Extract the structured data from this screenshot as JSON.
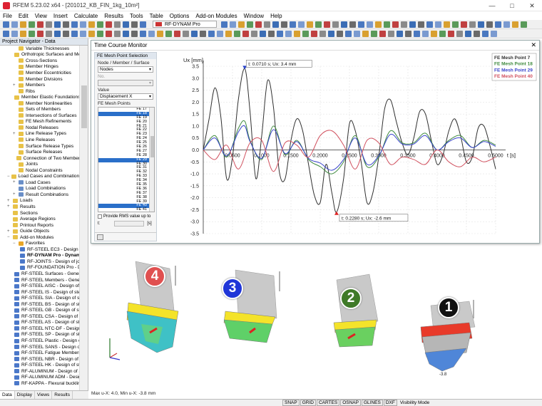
{
  "window": {
    "title": "RFEM 5.23.02 x64 - [201012_KB_FIN_1kg_10m²]",
    "controls": [
      "—",
      "□",
      "✕"
    ]
  },
  "menu": [
    "File",
    "Edit",
    "View",
    "Insert",
    "Calculate",
    "Results",
    "Tools",
    "Table",
    "Options",
    "Add-on Modules",
    "Window",
    "Help"
  ],
  "toolbar": {
    "module_selector": "RF-DYNAM Pro"
  },
  "navigator": {
    "title": "Project Navigator - Data",
    "items": [
      {
        "label": "Variable Thicknesses",
        "indent": 2,
        "icon": "folder"
      },
      {
        "label": "Orthotropic Surfaces and Me",
        "indent": 2,
        "icon": "folder"
      },
      {
        "label": "Cross-Sections",
        "indent": 2,
        "icon": "folder"
      },
      {
        "label": "Member Hinges",
        "indent": 2,
        "icon": "folder"
      },
      {
        "label": "Member Eccentricities",
        "indent": 2,
        "icon": "folder"
      },
      {
        "label": "Member Divisions",
        "indent": 2,
        "icon": "folder"
      },
      {
        "label": "Members",
        "indent": 2,
        "icon": "folder",
        "exp": "+"
      },
      {
        "label": "Ribs",
        "indent": 2,
        "icon": "folder"
      },
      {
        "label": "Member Elastic Foundations",
        "indent": 2,
        "icon": "folder"
      },
      {
        "label": "Member Nonlinearities",
        "indent": 2,
        "icon": "folder"
      },
      {
        "label": "Sets of Members",
        "indent": 2,
        "icon": "folder"
      },
      {
        "label": "Intersections of Surfaces",
        "indent": 2,
        "icon": "folder"
      },
      {
        "label": "FE Mesh Refinements",
        "indent": 2,
        "icon": "folder"
      },
      {
        "label": "Nodal Releases",
        "indent": 2,
        "icon": "folder"
      },
      {
        "label": "Line Release Types",
        "indent": 2,
        "icon": "folder",
        "exp": "+"
      },
      {
        "label": "Line Releases",
        "indent": 2,
        "icon": "folder"
      },
      {
        "label": "Surface Release Types",
        "indent": 2,
        "icon": "folder"
      },
      {
        "label": "Surface Releases",
        "indent": 2,
        "icon": "folder"
      },
      {
        "label": "Connection of Two Member",
        "indent": 2,
        "icon": "folder"
      },
      {
        "label": "Joints",
        "indent": 2,
        "icon": "folder"
      },
      {
        "label": "Nodal Constraints",
        "indent": 2,
        "icon": "folder"
      },
      {
        "label": "Load Cases and Combinations",
        "indent": 1,
        "icon": "folder",
        "exp": "−"
      },
      {
        "label": "Load Cases",
        "indent": 2,
        "icon": "item",
        "exp": "+"
      },
      {
        "label": "Load Combinations",
        "indent": 2,
        "icon": "item"
      },
      {
        "label": "Result Combinations",
        "indent": 2,
        "icon": "item",
        "exp": "+"
      },
      {
        "label": "Loads",
        "indent": 1,
        "icon": "folder",
        "exp": "+"
      },
      {
        "label": "Results",
        "indent": 1,
        "icon": "folder",
        "exp": "+"
      },
      {
        "label": "Sections",
        "indent": 1,
        "icon": "folder"
      },
      {
        "label": "Average Regions",
        "indent": 1,
        "icon": "folder"
      },
      {
        "label": "Printout Reports",
        "indent": 1,
        "icon": "folder"
      },
      {
        "label": "Guide Objects",
        "indent": 1,
        "icon": "folder",
        "exp": "+"
      },
      {
        "label": "Add-on Modules",
        "indent": 1,
        "icon": "folder",
        "exp": "−"
      },
      {
        "label": "Favorites",
        "indent": 2,
        "icon": "fav",
        "exp": "−"
      },
      {
        "label": "RF-STEEL EC3 - Design of st",
        "indent": 3,
        "icon": "mod"
      },
      {
        "label": "RF-DYNAM Pro - Dynam",
        "indent": 3,
        "icon": "mod",
        "bold": true
      },
      {
        "label": "RF-JOINTS - Design of jo",
        "indent": 3,
        "icon": "mod"
      },
      {
        "label": "RF-FOUNDATION Pro - D",
        "indent": 3,
        "icon": "mod"
      },
      {
        "label": "RF-STEEL Surfaces - General",
        "indent": 2,
        "icon": "mod"
      },
      {
        "label": "RF-STEEL Members - Genera",
        "indent": 2,
        "icon": "mod"
      },
      {
        "label": "RF-STEEL AISC - Design of st",
        "indent": 2,
        "icon": "mod"
      },
      {
        "label": "RF-STEEL IS - Design of stee",
        "indent": 2,
        "icon": "mod"
      },
      {
        "label": "RF-STEEL SIA - Design of ste",
        "indent": 2,
        "icon": "mod"
      },
      {
        "label": "RF-STEEL BS - Design of stee",
        "indent": 2,
        "icon": "mod"
      },
      {
        "label": "RF-STEEL GB - Design of ste",
        "indent": 2,
        "icon": "mod"
      },
      {
        "label": "RF-STEEL CSA - Design of st",
        "indent": 2,
        "icon": "mod"
      },
      {
        "label": "RF-STEEL AS - Design of ste",
        "indent": 2,
        "icon": "mod"
      },
      {
        "label": "RF-STEEL NTC-DF - Design",
        "indent": 2,
        "icon": "mod"
      },
      {
        "label": "RF-STEEL SP - Design of ste",
        "indent": 2,
        "icon": "mod"
      },
      {
        "label": "RF-STEEL Plastic - Design o",
        "indent": 2,
        "icon": "mod"
      },
      {
        "label": "RF-STEEL SANS - Design of st",
        "indent": 2,
        "icon": "mod"
      },
      {
        "label": "RF-STEEL Fatigue Members -",
        "indent": 2,
        "icon": "mod"
      },
      {
        "label": "RF-STEEL NBR - Design of st",
        "indent": 2,
        "icon": "mod"
      },
      {
        "label": "RF-STEEL HK - Design of ste",
        "indent": 2,
        "icon": "mod"
      },
      {
        "label": "RF-ALUMINUM - Design of a",
        "indent": 2,
        "icon": "mod"
      },
      {
        "label": "RF-ALUMINUM ADM - Design",
        "indent": 2,
        "icon": "mod"
      },
      {
        "label": "RF-KAPPA - Flexural bucklin",
        "indent": 2,
        "icon": "mod"
      }
    ],
    "tabs": [
      "Data",
      "Display",
      "Views",
      "Results"
    ]
  },
  "monitor": {
    "title": "Time Course Monitor",
    "close": "✕",
    "selection": {
      "header": "FE Mesh Point Selection",
      "node_label": "Node / Member / Surface",
      "node_value": "Nodes",
      "no_label": "No.",
      "value_label": "Value",
      "value_value": "Displacement X",
      "points_label": "FE Mesh Points",
      "points": [
        "FE 17",
        "FE 18",
        "FE 19",
        "FE 20",
        "FE 21",
        "FE 22",
        "FE 23",
        "FE 24",
        "FE 25",
        "FE 26",
        "FE 27",
        "FE 28",
        "FE 29",
        "FE 30",
        "FE 31",
        "FE 32",
        "FE 33",
        "FE 34",
        "FE 35",
        "FE 36",
        "FE 37",
        "FE 38",
        "FE 39",
        "FE 40",
        "FE 41"
      ],
      "selected_points": [
        "FE 18",
        "FE 29",
        "FE 40"
      ],
      "rms_label": "Provide RMS value up to",
      "t_label": "t:",
      "t_unit": "[s]"
    }
  },
  "chart_data": {
    "type": "line",
    "ylabel": "Ux [mm]",
    "xlabel": "t [s]",
    "xlim": [
      0,
      0.5
    ],
    "ylim": [
      -3.5,
      3.5
    ],
    "x_ticks": [
      0.05,
      0.1,
      0.15,
      0.2,
      0.25,
      0.3,
      0.35,
      0.4,
      0.45,
      0.5
    ],
    "x_tick_labels": [
      "0.0500",
      "0.1000",
      "0.1500",
      "0.2000",
      "0.2500",
      "0.3000",
      "0.3500",
      "0.4000",
      "0.4500",
      "0.5000"
    ],
    "y_ticks": [
      -3.5,
      -3,
      -2.5,
      -2,
      -1.5,
      -1,
      -0.5,
      0,
      0.5,
      1,
      1.5,
      2,
      2.5,
      3,
      3.5
    ],
    "y_tick_labels": [
      "-3.5",
      "-3.0",
      "-2.5",
      "-2.0",
      "-1.5",
      "-1.0",
      "-0.5",
      "0.0",
      "0.5",
      "1.0",
      "1.5",
      "2.0",
      "2.5",
      "3.0",
      "3.5"
    ],
    "grid": true,
    "legend_position": "top-right",
    "series": [
      {
        "name": "FE Mesh Point 7",
        "color": "#303030",
        "x": [
          0,
          0.01,
          0.02,
          0.03,
          0.04,
          0.05,
          0.06,
          0.071,
          0.08,
          0.09,
          0.1,
          0.11,
          0.12,
          0.13,
          0.14,
          0.15,
          0.16,
          0.17,
          0.18,
          0.19,
          0.2,
          0.21,
          0.22,
          0.228,
          0.24,
          0.25,
          0.26,
          0.27,
          0.28,
          0.29,
          0.3,
          0.31,
          0.32,
          0.33,
          0.34,
          0.35,
          0.36,
          0.37,
          0.38,
          0.39,
          0.4,
          0.41,
          0.42,
          0.43,
          0.44,
          0.45,
          0.46,
          0.47,
          0.48,
          0.49,
          0.5
        ],
        "y": [
          0,
          1.3,
          2.6,
          1.4,
          -1.2,
          -0.3,
          2.1,
          3.4,
          1.6,
          -1.2,
          0.6,
          2.9,
          1.8,
          -0.9,
          -1.2,
          0.4,
          1.3,
          0.8,
          -0.6,
          -1.9,
          -2.2,
          -0.6,
          -1.8,
          -2.6,
          -1.2,
          1.1,
          0.8,
          -0.5,
          -2.2,
          -1.8,
          -0.3,
          1.7,
          2.1,
          1.2,
          0.3,
          -0.2,
          0.5,
          1.6,
          1.5,
          0.4,
          -0.6,
          -0.2,
          0.8,
          1.3,
          0.6,
          -0.5,
          -0.3,
          0.9,
          1.0,
          0.2,
          -0.8
        ]
      },
      {
        "name": "FE Mesh Point 18",
        "color": "#3f8a3f",
        "x": [
          0,
          0.02,
          0.04,
          0.06,
          0.071,
          0.08,
          0.1,
          0.12,
          0.14,
          0.16,
          0.18,
          0.2,
          0.22,
          0.24,
          0.26,
          0.28,
          0.3,
          0.32,
          0.34,
          0.36,
          0.38,
          0.4,
          0.42,
          0.44,
          0.46,
          0.48,
          0.5
        ],
        "y": [
          0,
          0.6,
          -0.3,
          0.9,
          1.2,
          0.4,
          -0.4,
          1.0,
          -0.2,
          0.4,
          -0.4,
          -0.7,
          -1.0,
          -0.5,
          0.6,
          -0.7,
          -0.3,
          0.8,
          0.3,
          0.3,
          0.7,
          0.0,
          0.4,
          0.6,
          0.1,
          0.4,
          0.2
        ]
      },
      {
        "name": "FE Mesh Point 29",
        "color": "#3a44cc",
        "x": [
          0,
          0.02,
          0.04,
          0.06,
          0.071,
          0.08,
          0.1,
          0.12,
          0.14,
          0.16,
          0.18,
          0.2,
          0.22,
          0.24,
          0.26,
          0.28,
          0.3,
          0.32,
          0.34,
          0.36,
          0.38,
          0.4,
          0.42,
          0.44,
          0.46,
          0.48,
          0.5
        ],
        "y": [
          0,
          0.5,
          -0.25,
          0.75,
          1.0,
          0.35,
          -0.35,
          0.85,
          -0.15,
          0.35,
          -0.35,
          -0.55,
          -0.85,
          -0.4,
          0.5,
          -0.6,
          -0.25,
          0.65,
          0.25,
          0.25,
          0.6,
          0.0,
          0.35,
          0.5,
          0.1,
          0.35,
          0.15
        ]
      },
      {
        "name": "FE Mesh Point 40",
        "color": "#d0505e",
        "x": [
          0,
          0.02,
          0.04,
          0.06,
          0.08,
          0.1,
          0.12,
          0.14,
          0.16,
          0.18,
          0.2,
          0.22,
          0.24,
          0.26,
          0.28,
          0.3,
          0.32,
          0.34,
          0.36,
          0.38,
          0.4,
          0.42,
          0.44,
          0.46,
          0.48,
          0.5
        ],
        "y": [
          0,
          -0.4,
          0.2,
          -0.8,
          0.3,
          0.4,
          -0.9,
          0.3,
          0.2,
          -0.3,
          0.6,
          0.8,
          0.2,
          -0.8,
          0.4,
          0.3,
          -0.6,
          -0.3,
          -0.4,
          -0.6,
          0.0,
          -0.5,
          -0.7,
          -0.3,
          -0.5,
          -0.3
        ]
      }
    ],
    "annotations": [
      {
        "text": "t: 0.0710 s; Ux: 3.4 mm",
        "x": 0.071,
        "y": 3.4,
        "kind": "max"
      },
      {
        "text": "t: 0.2280 s; Ux: -2.6 mm",
        "x": 0.228,
        "y": -2.6,
        "kind": "min"
      }
    ]
  },
  "models": [
    {
      "number": "4",
      "color": "#e05050"
    },
    {
      "number": "3",
      "color": "#2036d8"
    },
    {
      "number": "2",
      "color": "#3f7a28"
    },
    {
      "number": "1",
      "color": "#111111"
    }
  ],
  "model1_value": "-3.8",
  "status_info": "Max u-X: 4.0, Min u-X: -3.8 mm",
  "statusbar": {
    "toggles": [
      "SNAP",
      "GRID",
      "CARTES",
      "OSNAP",
      "GLINES",
      "DXF"
    ],
    "mode": "Visibility Mode"
  }
}
